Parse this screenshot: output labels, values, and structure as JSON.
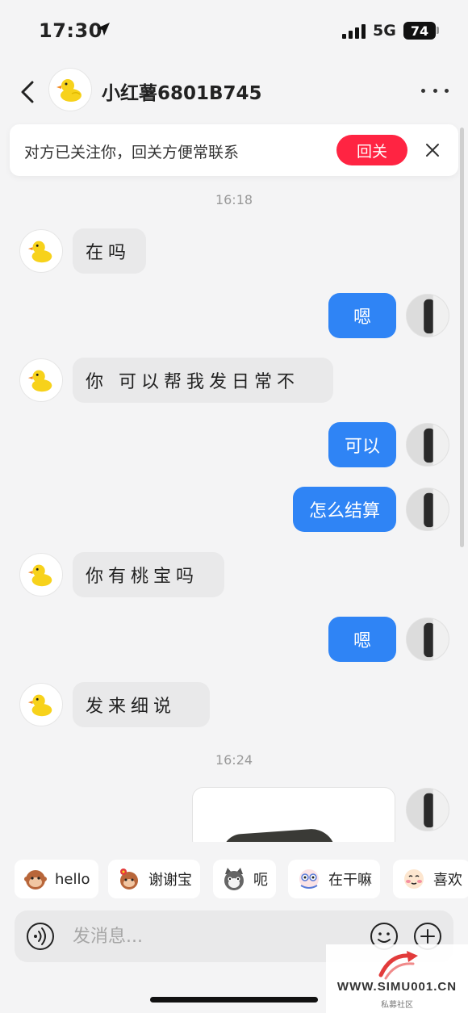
{
  "status": {
    "time": "17:30",
    "network": "5G",
    "battery": "74"
  },
  "header": {
    "title": "小红薯6801B745"
  },
  "banner": {
    "text": "对方已关注你，回关方便常联系",
    "button": "回关"
  },
  "messages": [
    {
      "type": "time",
      "text": "16:18"
    },
    {
      "type": "in",
      "text": "在吗"
    },
    {
      "type": "out",
      "text": "嗯"
    },
    {
      "type": "in",
      "text": "你 可以帮我发日常不"
    },
    {
      "type": "out",
      "text": "可以"
    },
    {
      "type": "out",
      "text": "怎么结算"
    },
    {
      "type": "in",
      "text": "你有桃宝吗"
    },
    {
      "type": "out",
      "text": "嗯"
    },
    {
      "type": "in",
      "text": "发来细说"
    },
    {
      "type": "time",
      "text": "16:24"
    },
    {
      "type": "out-image",
      "text": ""
    }
  ],
  "quick_replies": [
    {
      "label": "hello",
      "icon": "monkey-emoji-icon"
    },
    {
      "label": "谢谢宝",
      "icon": "monkey-flower-emoji-icon"
    },
    {
      "label": "呃",
      "icon": "cat-emoji-icon"
    },
    {
      "label": "在干嘛",
      "icon": "peeking-emoji-icon"
    },
    {
      "label": "喜欢",
      "icon": "blush-emoji-icon"
    }
  ],
  "input": {
    "placeholder": "发消息..."
  },
  "watermark": {
    "url": "WWW.SIMU001.CN",
    "sub": "私募社区"
  },
  "colors": {
    "accent_red": "#ff2442",
    "bubble_blue": "#2f84f5",
    "duck_yellow": "#f7d21b"
  }
}
